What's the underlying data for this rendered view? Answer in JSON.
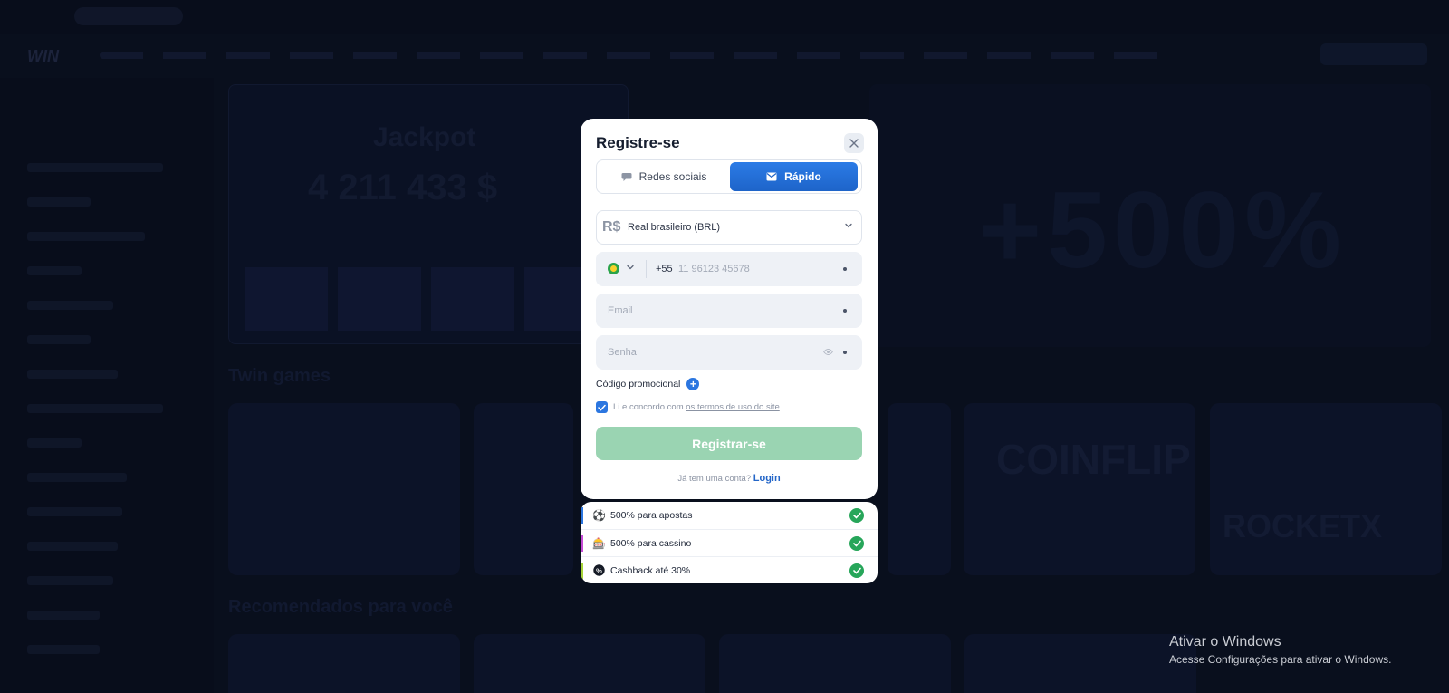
{
  "modal": {
    "title": "Registre-se",
    "tabs": [
      {
        "label": "Redes sociais",
        "icon": "chat-bubble-icon",
        "active": false
      },
      {
        "label": "Rápido",
        "icon": "envelope-icon",
        "active": true
      }
    ],
    "currency": {
      "symbol": "R$",
      "name": "Real brasileiro (BRL)"
    },
    "phone": {
      "country_code": "+55",
      "placeholder": "11 96123 45678",
      "flag": "brazil-flag-icon"
    },
    "email": {
      "placeholder": "Email"
    },
    "password": {
      "placeholder": "Senha"
    },
    "promo_label": "Código promocional",
    "terms": {
      "prefix": "Li e concordo com ",
      "link": "os termos de uso do site",
      "checked": true
    },
    "submit_label": "Registrar-se",
    "login": {
      "prompt": "Já tem uma conta? ",
      "link": "Login"
    }
  },
  "bonuses": [
    {
      "label": "500% para apostas",
      "icon": "soccer-ball-icon",
      "accent": "#2b76e0"
    },
    {
      "label": "500% para cassino",
      "icon": "casino-icon",
      "accent": "#c64bd6"
    },
    {
      "label": "Cashback até 30%",
      "icon": "cashback-icon",
      "accent": "#a7d43a"
    }
  ],
  "background": {
    "logo": "WIN",
    "jackpot_title": "Jackpot",
    "jackpot_value": "4 211 433 $",
    "banner_text": "+500%",
    "section_twin": "Twin games",
    "section_recommended": "Recomendados para você",
    "card_coinflip": "COINFLIP",
    "card_rocketx": "ROCKETX"
  },
  "watermark": {
    "title": "Ativar o Windows",
    "subtitle": "Acesse Configurações para ativar o Windows."
  },
  "colors": {
    "primary": "#2b76e0",
    "submit_disabled": "#9ad4b2",
    "success": "#27a65a",
    "backdrop": "#0d1426"
  }
}
